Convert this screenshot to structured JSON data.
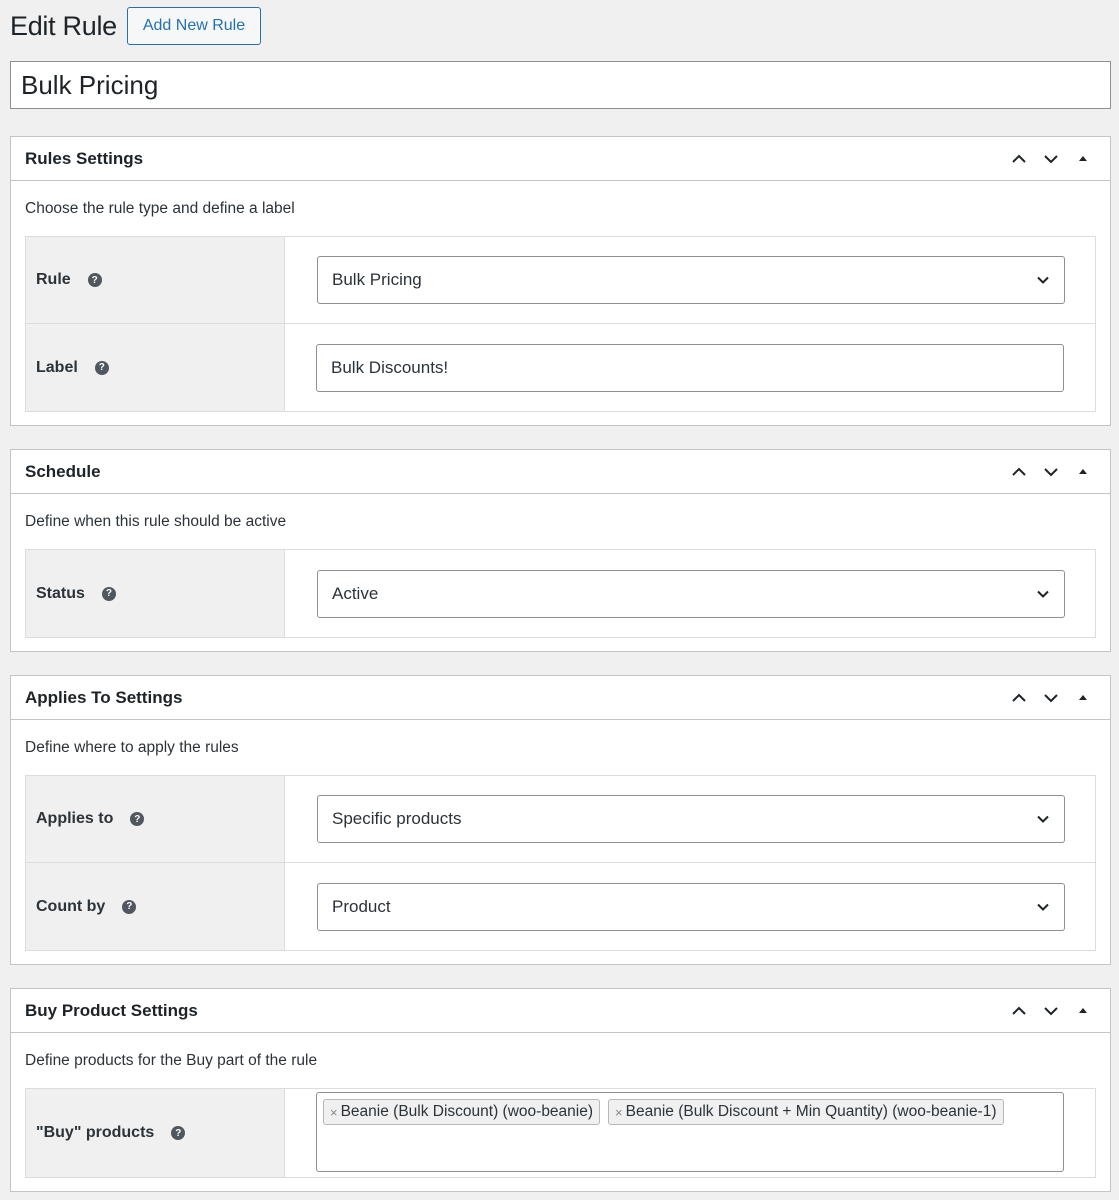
{
  "header": {
    "title": "Edit Rule",
    "add_new_label": "Add New Rule"
  },
  "title_field": {
    "value": "Bulk Pricing"
  },
  "sections": {
    "rules_settings": {
      "title": "Rules Settings",
      "description": "Choose the rule type and define a label",
      "rule_label": "Rule",
      "rule_value": "Bulk Pricing",
      "label_label": "Label",
      "label_value": "Bulk Discounts!"
    },
    "schedule": {
      "title": "Schedule",
      "description": "Define when this rule should be active",
      "status_label": "Status",
      "status_value": "Active"
    },
    "applies_to": {
      "title": "Applies To Settings",
      "description": "Define where to apply the rules",
      "applies_label": "Applies to",
      "applies_value": "Specific products",
      "count_label": "Count by",
      "count_value": "Product"
    },
    "buy_product": {
      "title": "Buy Product Settings",
      "description": "Define products for the Buy part of the rule",
      "buy_label": "\"Buy\" products",
      "tokens": [
        "Beanie (Bulk Discount) (woo-beanie)",
        "Beanie (Bulk Discount + Min Quantity) (woo-beanie-1)"
      ]
    }
  },
  "icons": {
    "help": "?",
    "token_remove": "×"
  }
}
